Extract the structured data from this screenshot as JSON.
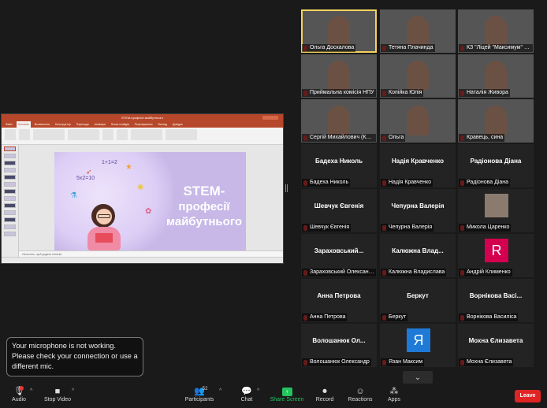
{
  "shared_screen": {
    "window_title": "STEM-професії майбутнього",
    "ribbon_tabs": [
      "Файл",
      "Основне",
      "Вставлення",
      "Конструктор",
      "Переходи",
      "Анімація",
      "Показ слайдів",
      "Рецензування",
      "Вигляд",
      "Довідка"
    ],
    "active_tab_index": 1,
    "slide_title_line1": "STEM-",
    "slide_title_line2": "професії",
    "slide_title_line3": "майбутнього",
    "slide_math_1": "1+1=2",
    "slide_math_2": "5x2=10",
    "notes_placeholder": "Натисніть, щоб додати нотатки",
    "slide_accent_color": "#c7b8e8"
  },
  "participants": [
    {
      "name": "Ольга Доскалова",
      "type": "video",
      "active_speaker": true
    },
    {
      "name": "Тетяна Плачинда",
      "type": "video"
    },
    {
      "name": "КЗ \"Ліцей \"Максимум\" КМР\"",
      "type": "video"
    },
    {
      "name": "Приймальна комісія НПУ",
      "type": "video"
    },
    {
      "name": "Копійка Юлія",
      "type": "video"
    },
    {
      "name": "Наталія Живора",
      "type": "video"
    },
    {
      "name": "Сергій Михайлович (Київ)",
      "type": "video"
    },
    {
      "name": "Ольга",
      "type": "video"
    },
    {
      "name": "Кравець, сина",
      "type": "video"
    },
    {
      "name": "Бадеха Николь",
      "display": "Бадеха Николь",
      "type": "name"
    },
    {
      "name": "Надія Кравченко",
      "display": "Надія Кравченко",
      "type": "name"
    },
    {
      "name": "Радіонова Діана",
      "display": "Радіонова Діана",
      "type": "name"
    },
    {
      "name": "Шевчук Євгенія",
      "display": "Шевчук Євгенія",
      "type": "name"
    },
    {
      "name": "Чепурна Валерія",
      "display": "Чепурна Валерія",
      "type": "name"
    },
    {
      "name": "Микола Царенко",
      "type": "photo"
    },
    {
      "name": "Зараховський Олександр",
      "display": "Зараховський...",
      "type": "name"
    },
    {
      "name": "Калюжна Владислава",
      "display": "Калюжна Влад...",
      "type": "name"
    },
    {
      "name": "Андрій Клименко",
      "type": "avatar",
      "letter": "R",
      "color": "#d2004e"
    },
    {
      "name": "Анна Петрова",
      "display": "Анна Петрова",
      "type": "name"
    },
    {
      "name": "Беркут",
      "display": "Беркут",
      "type": "name"
    },
    {
      "name": "Ворнікова Василіса",
      "display": "Ворнікова Васі...",
      "type": "name"
    },
    {
      "name": "Волошанюк Олександр",
      "display": "Волошанюк Ол...",
      "type": "name"
    },
    {
      "name": "Язан Максим",
      "type": "avatar",
      "letter": "Я",
      "color": "#1e7ad6"
    },
    {
      "name": "Мохна Єлизавета",
      "display": "Мохна Єлизавета",
      "type": "name"
    }
  ],
  "toast": {
    "message": "Your microphone is not working. Please check your connection or use a different mic."
  },
  "toolbar": {
    "audio": "Audio",
    "mic_badge": "!",
    "stop_video": "Stop Video",
    "participants": "Participants",
    "participants_count": "52",
    "chat": "Chat",
    "share_screen": "Share Screen",
    "record": "Record",
    "reactions": "Reactions",
    "apps": "Apps",
    "leave": "Leave"
  },
  "icons": {
    "mic": "microphone-icon",
    "video": "video-camera-icon",
    "participants": "people-icon",
    "chat": "chat-bubble-icon",
    "share": "share-arrow-icon",
    "record": "record-dot-icon",
    "reactions": "smiley-icon",
    "apps": "apps-grid-icon",
    "scroll": "chevron-down-icon"
  },
  "colors": {
    "accent_green": "#23c45e",
    "leave_red": "#e02424",
    "mute_red": "#e03c3c",
    "active_speaker": "#f4d35e"
  }
}
